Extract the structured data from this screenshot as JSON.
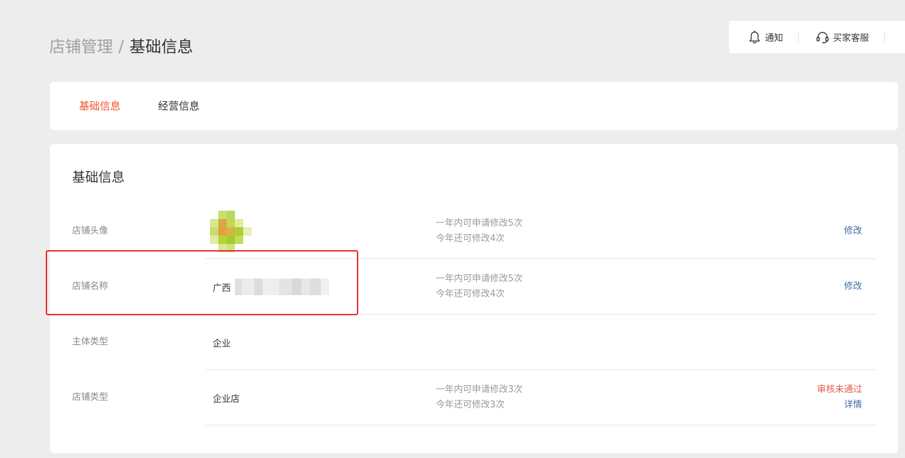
{
  "breadcrumb": {
    "parent": "店铺管理",
    "separator": "/",
    "current": "基础信息"
  },
  "toolbar": {
    "notify_label": "通知",
    "notify_icon": "bell-icon",
    "service_label": "买家客服",
    "service_icon": "headset-icon"
  },
  "tabs": [
    {
      "label": "基础信息",
      "active": true
    },
    {
      "label": "经营信息",
      "active": false
    }
  ],
  "section": {
    "title": "基础信息"
  },
  "rows": [
    {
      "label": "店铺头像",
      "value": "",
      "limit_line1": "一年内可申请修改5次",
      "limit_line2": "今年还可修改4次",
      "action": "修改"
    },
    {
      "label": "店铺名称",
      "value": "广西",
      "limit_line1": "一年内可申请修改5次",
      "limit_line2": "今年还可修改4次",
      "action": "修改"
    },
    {
      "label": "主体类型",
      "value": "企业"
    },
    {
      "label": "店铺类型",
      "value": "企业店",
      "limit_line1": "一年内可申请修改3次",
      "limit_line2": "今年还可修改3次",
      "status": "审核未通过",
      "action": "详情"
    }
  ],
  "colors": {
    "accent": "#f0552e",
    "link": "#3d6aa8",
    "error": "#e45b4d",
    "highlight_frame": "#e3312d"
  }
}
